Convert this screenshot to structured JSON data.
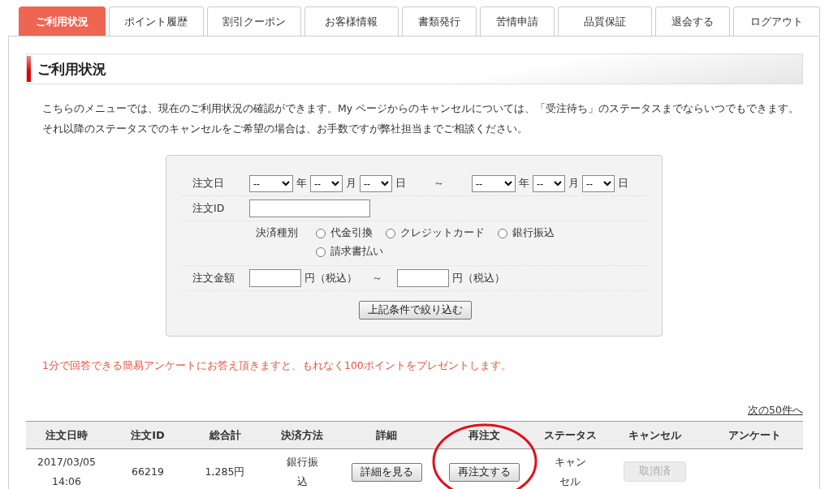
{
  "tabs": [
    {
      "label": "ご利用状況",
      "selected": true
    },
    {
      "label": "ポイント履歴",
      "selected": false
    },
    {
      "label": "割引クーポン",
      "selected": false
    },
    {
      "label": "お客様情報",
      "selected": false
    },
    {
      "label": "書類発行",
      "selected": false
    },
    {
      "label": "苦情申請",
      "selected": false
    },
    {
      "label": "品質保証",
      "selected": false
    },
    {
      "label": "退会する",
      "selected": false
    },
    {
      "label": "ログアウト",
      "selected": false
    }
  ],
  "section_title": "ご利用状況",
  "intro": "こちらのメニューでは、現在のご利用状況の確認ができます。My ページからのキャンセルについては、「受注待ち」のステータスまでならいつでもできます。それ以降のステータスでのキャンセルをご希望の場合は、お手数ですが弊社担当までご相談ください。",
  "search_form": {
    "order_date": {
      "label": "注文日",
      "from": [
        {
          "value": "--",
          "unit": "年"
        },
        {
          "value": "--",
          "unit": "月"
        },
        {
          "value": "--",
          "unit": "日"
        }
      ],
      "separator": "～",
      "to": [
        {
          "value": "--",
          "unit": "年"
        },
        {
          "value": "--",
          "unit": "月"
        },
        {
          "value": "--",
          "unit": "日"
        }
      ]
    },
    "order_id": {
      "label": "注文ID"
    },
    "payment": {
      "label": "決済種別",
      "options": [
        {
          "label": "代金引換",
          "selected": false
        },
        {
          "label": "クレジットカード",
          "selected": false
        },
        {
          "label": "銀行振込",
          "selected": false
        },
        {
          "label": "請求書払い",
          "selected": false
        }
      ]
    },
    "amount": {
      "label": "注文金額",
      "unit_from": "円（税込）",
      "separator": "～",
      "unit_to": "円（税込）"
    },
    "submit": "上記条件で絞り込む"
  },
  "notice": "1分で回答できる簡易アンケートにお答え頂きますと、もれなく100ポイントをプレゼントします。",
  "next_link": "次の50件へ",
  "table": {
    "columns": [
      "注文日時",
      "注文ID",
      "総合計",
      "決済方法",
      "詳細",
      "再注文",
      "ステータス",
      "キャンセル",
      "アンケート"
    ],
    "rows": [
      {
        "date": "2017/03/05 14:06",
        "id": "66219",
        "total": "1,285円",
        "payment": "銀行振込",
        "detail_button": "詳細を見る",
        "reorder_button": "再注文する",
        "status": "キャンセル",
        "cancel_button": {
          "label": "取消済",
          "disabled": true
        }
      }
    ]
  }
}
